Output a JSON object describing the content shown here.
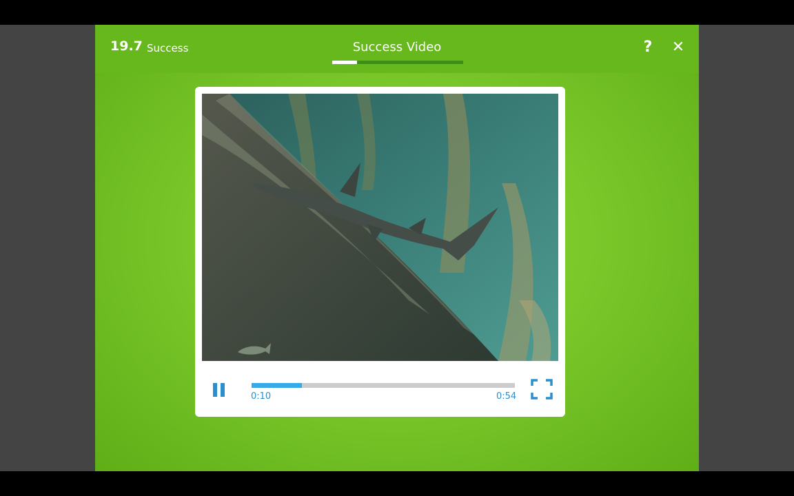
{
  "header": {
    "section_number": "19.7",
    "section_name": "Success",
    "title": "Success Video",
    "progress_fraction": 0.19,
    "help_label": "?",
    "close_label": "✕"
  },
  "player": {
    "current_time": "0:10",
    "total_time": "0:54",
    "played_fraction": 0.19,
    "state": "playing"
  },
  "icons": {
    "help": "help-icon",
    "close": "close-icon",
    "pause": "pause-icon",
    "fullscreen": "fullscreen-icon"
  },
  "colors": {
    "accent": "#36a9e6",
    "header": "#67b81d",
    "background": "#7ac82a"
  }
}
